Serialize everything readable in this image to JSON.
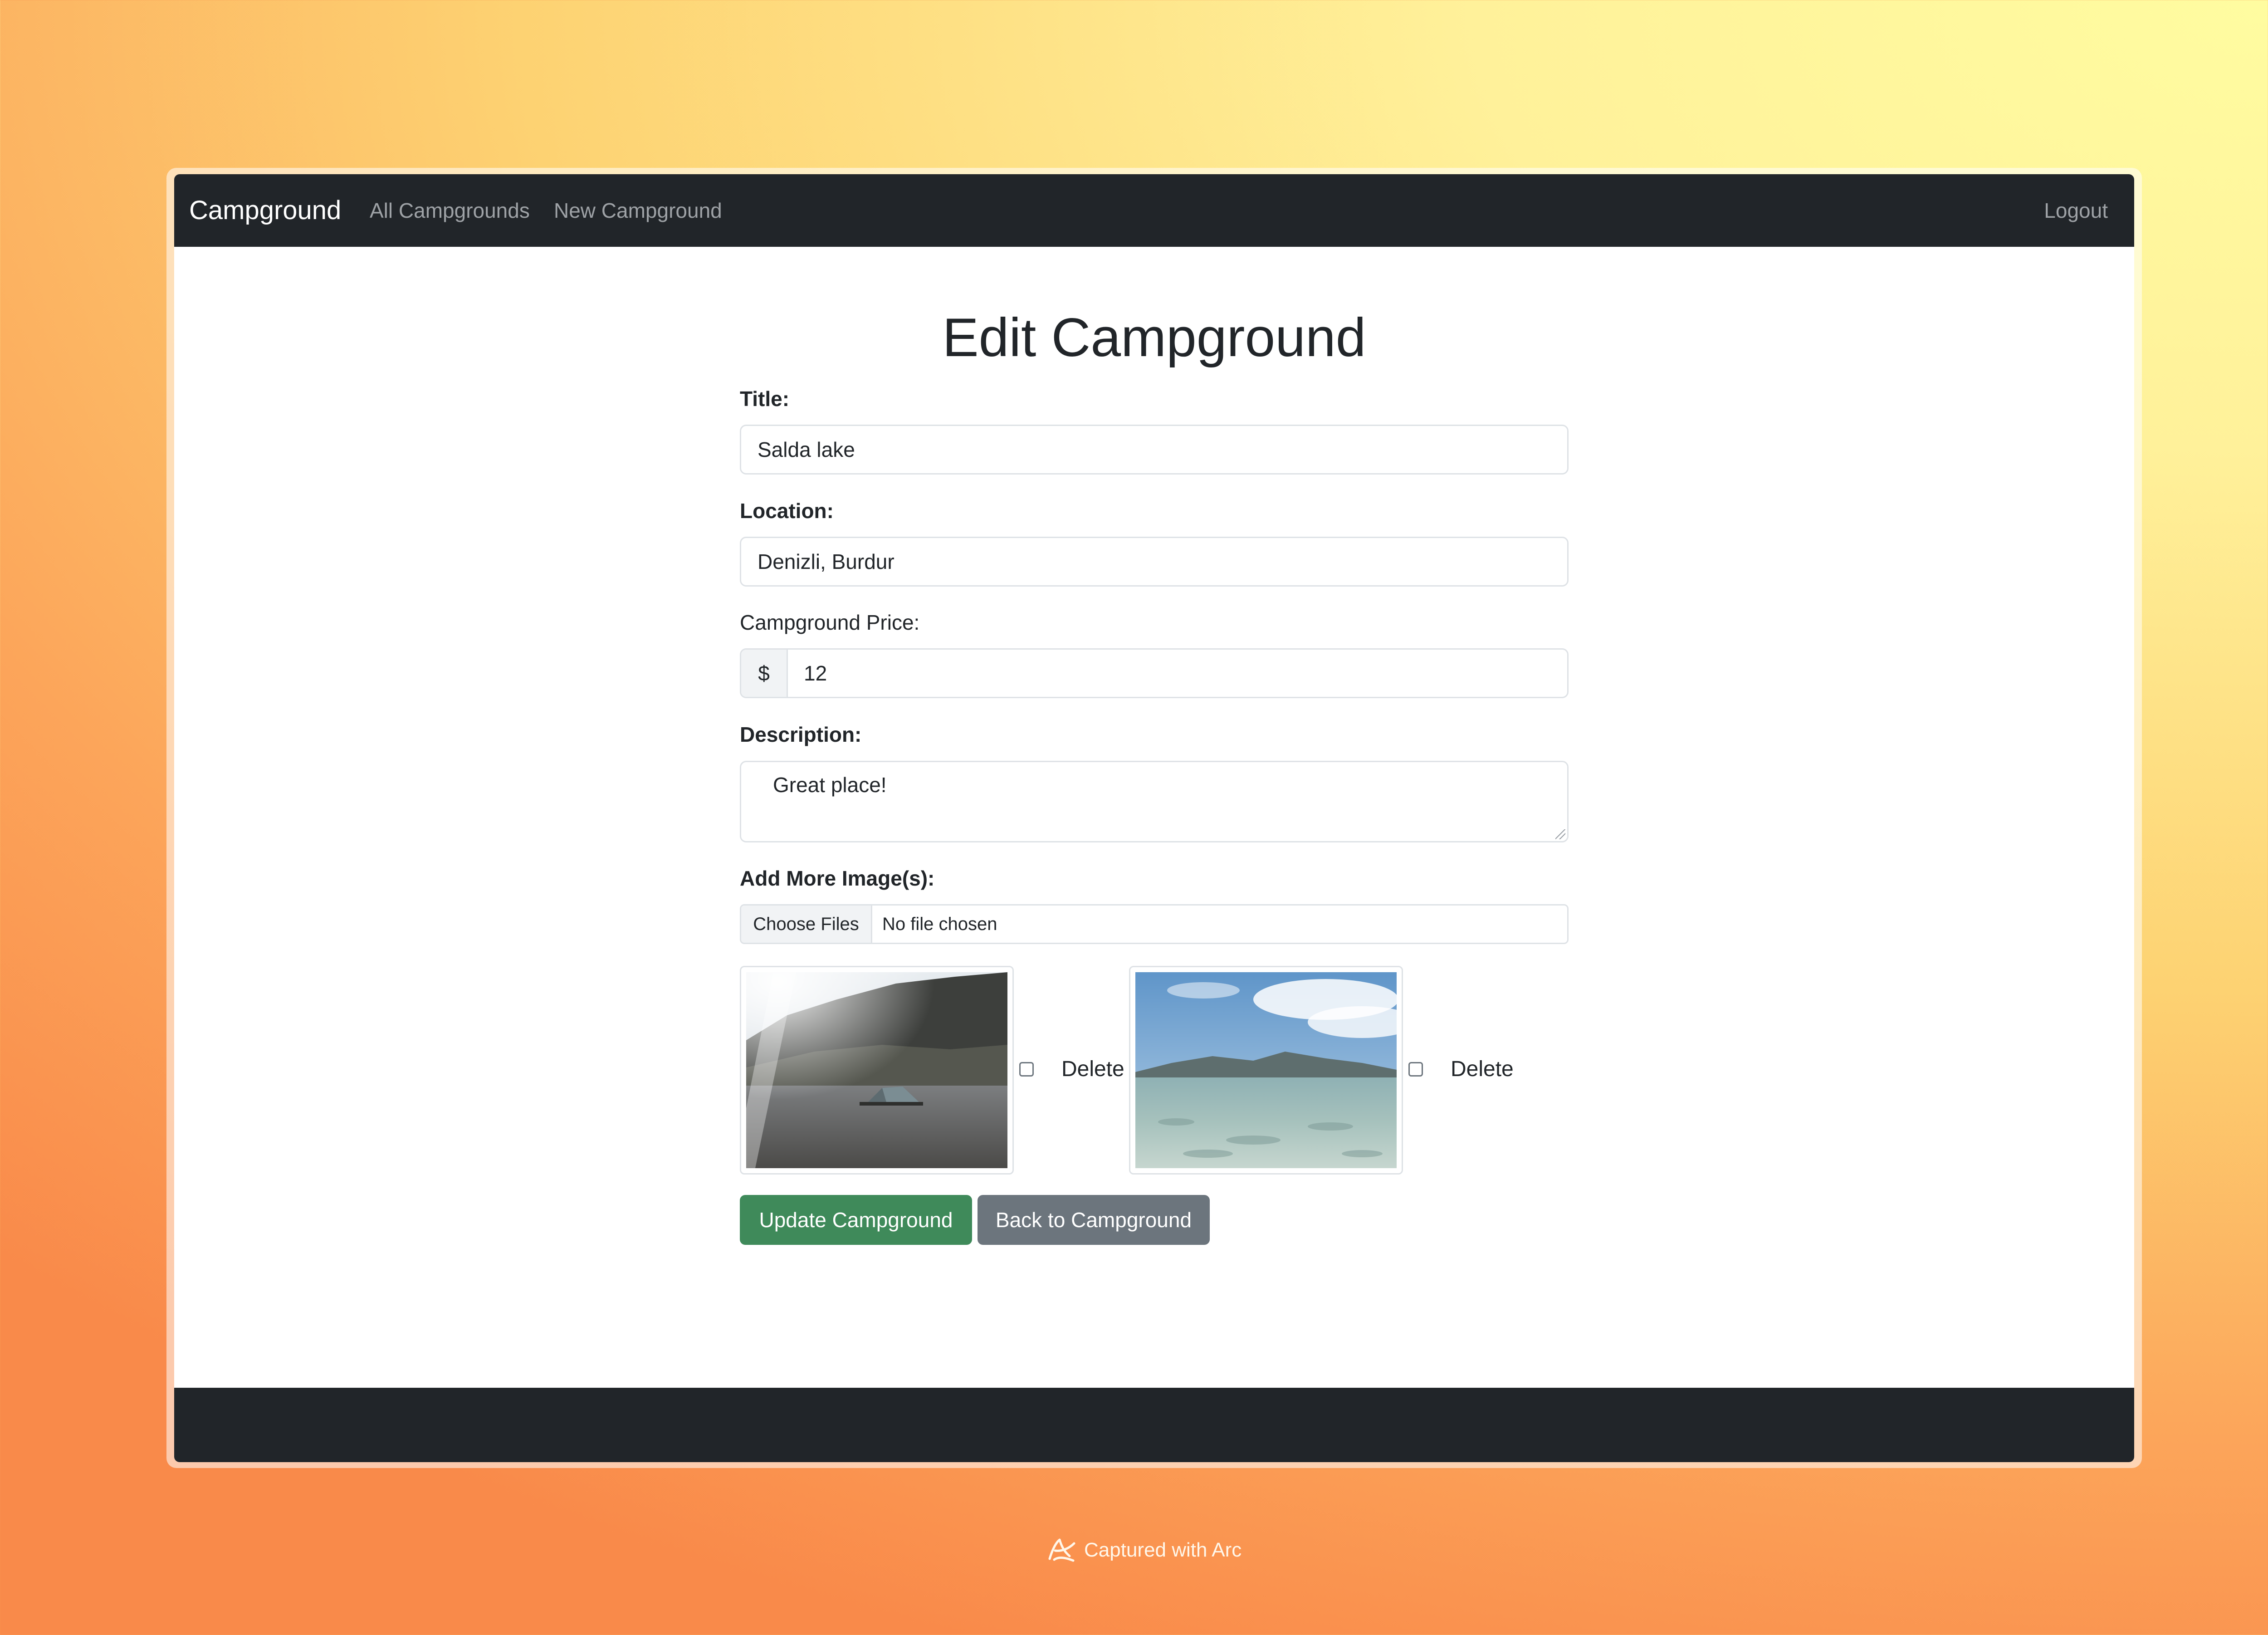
{
  "navbar": {
    "brand": "Campground",
    "links": [
      "All Campgrounds",
      "New Campground"
    ],
    "logout": "Logout"
  },
  "page": {
    "title": "Edit Campground"
  },
  "form": {
    "title_label": "Title:",
    "title_value": "Salda lake",
    "location_label": "Location:",
    "location_value": "Denizli, Burdur",
    "price_label": "Campground Price:",
    "price_prefix": "$",
    "price_value": "12",
    "description_label": "Description:",
    "description_value": "Great place!",
    "images_label": "Add More Image(s):",
    "file_button": "Choose Files",
    "file_status": "No file chosen",
    "images": [
      {
        "subject": "tent-on-rocky-lakeshore",
        "delete_label": "Delete",
        "checked": false
      },
      {
        "subject": "clear-lake-water-with-hills",
        "delete_label": "Delete",
        "checked": false
      }
    ],
    "submit_label": "Update Campground",
    "back_label": "Back to Campground"
  },
  "watermark": {
    "text": "Captured with Arc",
    "icon": "arc-logo-icon"
  },
  "colors": {
    "navbar": "#212529",
    "success": "#3f8a5a",
    "secondary": "#6c757d"
  }
}
